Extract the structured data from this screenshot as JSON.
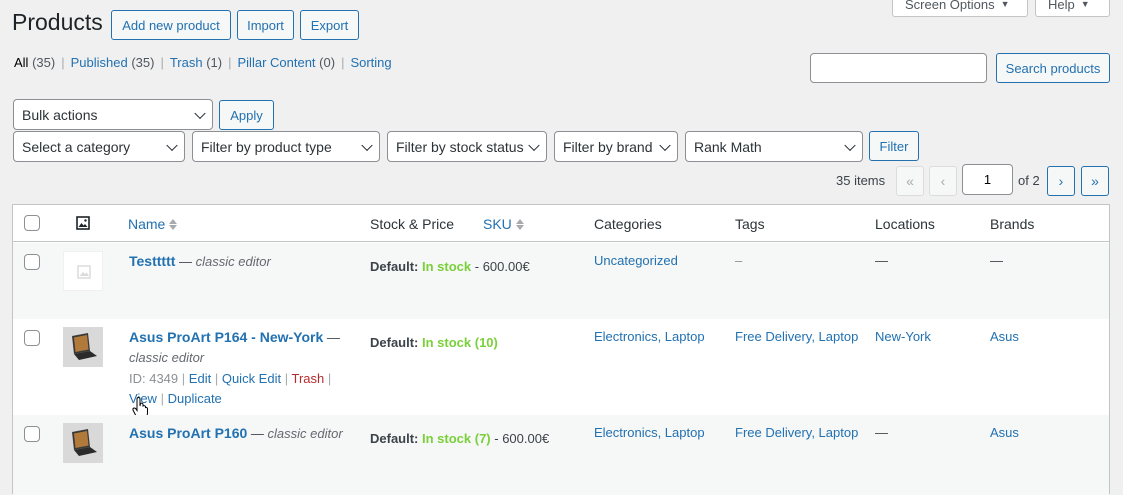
{
  "header": {
    "title": "Products",
    "buttons": {
      "add": "Add new product",
      "import": "Import",
      "export": "Export"
    },
    "screen_options": "Screen Options",
    "help": "Help"
  },
  "views": [
    {
      "label": "All",
      "count": "(35)"
    },
    {
      "label": "Published",
      "count": "(35)"
    },
    {
      "label": "Trash",
      "count": "(1)"
    },
    {
      "label": "Pillar Content",
      "count": "(0)"
    },
    {
      "label": "Sorting",
      "count": ""
    }
  ],
  "search": {
    "value": "",
    "button": "Search products"
  },
  "bulk": {
    "selected": "Bulk actions",
    "apply": "Apply"
  },
  "filters": {
    "category": "Select a category",
    "product_type": "Filter by product type",
    "stock_status": "Filter by stock status",
    "brand": "Filter by brand",
    "rank_math": "Rank Math",
    "button": "Filter"
  },
  "pagination": {
    "items": "35 items",
    "first": "«",
    "prev": "‹",
    "next": "›",
    "last": "»",
    "current": "1",
    "of": "of 2"
  },
  "columns": {
    "name": "Name",
    "stock_price": "Stock & Price",
    "sku": "SKU",
    "categories": "Categories",
    "tags": "Tags",
    "locations": "Locations",
    "brands": "Brands"
  },
  "rows": [
    {
      "name": "Testtttt",
      "sep": " — ",
      "editor": "classic editor",
      "stock_prefix": "Default:",
      "stock": "In stock",
      "price": " - 600.00€",
      "categories": "Uncategorized",
      "tags": "–",
      "locations": "—",
      "brands": "—"
    },
    {
      "name": "Asus ProArt P164 - New-York",
      "sep": " —",
      "editor": "classic editor",
      "stock_prefix": "Default:",
      "stock": "In stock (10)",
      "price": "",
      "categories": "Electronics, Laptop",
      "tags": "Free Delivery, Laptop",
      "locations": "New-York",
      "brands": "Asus",
      "actions": {
        "id": "ID: 4349",
        "edit": "Edit",
        "quick_edit": "Quick Edit",
        "trash": "Trash",
        "view": "View",
        "duplicate": "Duplicate",
        "divider": "|"
      }
    },
    {
      "name": "Asus ProArt P160",
      "sep": " — ",
      "editor": "classic editor",
      "stock_prefix": "Default:",
      "stock": "In stock (7)",
      "price": " - 600.00€",
      "categories": "Electronics, Laptop",
      "tags": "Free Delivery, Laptop",
      "locations": "—",
      "brands": "Asus"
    }
  ]
}
